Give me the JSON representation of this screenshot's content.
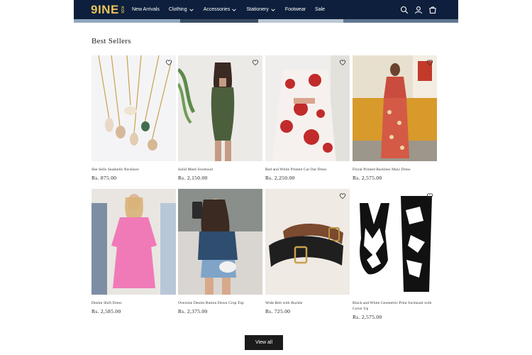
{
  "brand": {
    "logo_main": "9INE",
    "logo_side": "KOI"
  },
  "nav": {
    "items": [
      {
        "label": "New Arrivals",
        "dropdown": false
      },
      {
        "label": "Clothing",
        "dropdown": true
      },
      {
        "label": "Accessories",
        "dropdown": true
      },
      {
        "label": "Stationery",
        "dropdown": true
      },
      {
        "label": "Footwear",
        "dropdown": false
      },
      {
        "label": "Sale",
        "dropdown": false
      }
    ],
    "icons": [
      "search-icon",
      "account-icon",
      "cart-icon"
    ]
  },
  "section": {
    "title": "Best Sellers"
  },
  "products": [
    {
      "title": "She Sells Seashells Necklace",
      "price": "Rs. 875.00"
    },
    {
      "title": "Solid Mesh Swimsuit",
      "price": "Rs. 2,150.00"
    },
    {
      "title": "Red and White Printed Cut Out Dress",
      "price": "Rs. 2,250.00"
    },
    {
      "title": "Floral Printed Backless Maxi Dress",
      "price": "Rs. 2,575.00"
    },
    {
      "title": "Denim Shift Dress",
      "price": "Rs. 2,585.00"
    },
    {
      "title": "Oversize Denim Button Down Crop Top",
      "price": "Rs. 2,375.00"
    },
    {
      "title": "Wide Belt with Buckle",
      "price": "Rs. 725.00"
    },
    {
      "title": "Black and White Geometric Print Swimsuit with Cover Up",
      "price": "Rs. 2,575.00"
    }
  ],
  "actions": {
    "view_all": "View all"
  },
  "colors": {
    "header_bg": "#0d1f3c",
    "logo": "#e7c35a",
    "button_bg": "#1b1b1b"
  }
}
